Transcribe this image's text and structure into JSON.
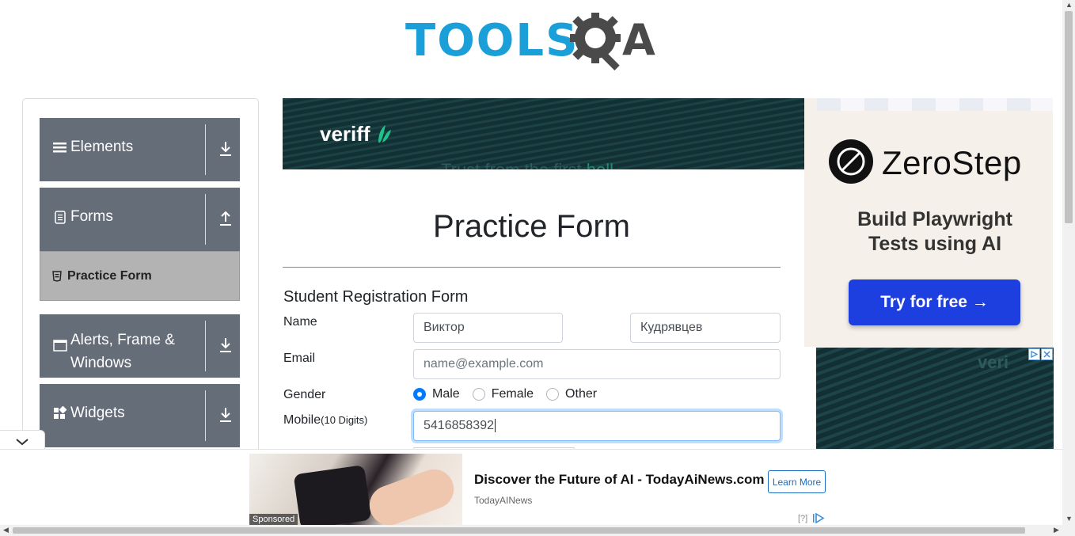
{
  "logo": {
    "text": "TOOLS",
    "suffix": "A",
    "colors": {
      "tools": "#1a9fd8",
      "qa": "#4a4a4a"
    }
  },
  "sidebar": {
    "groups": [
      {
        "label": "Elements",
        "icon": "hamburger-icon",
        "action_icon": "download-icon"
      },
      {
        "label": "Forms",
        "icon": "document-icon",
        "action_icon": "upload-icon",
        "items": [
          {
            "label": "Practice Form",
            "icon": "html5-icon",
            "active": true
          }
        ]
      },
      {
        "label": "Alerts, Frame & Windows",
        "icon": "window-icon",
        "action_icon": "download-icon"
      },
      {
        "label": "Widgets",
        "icon": "widgets-icon",
        "action_icon": "download-icon"
      }
    ],
    "collapse_icon": "chevron-down-icon"
  },
  "banner": {
    "brand": "veriff",
    "tagline_start": "Trust from the first ",
    "tagline_end": "hell"
  },
  "page": {
    "title": "Practice Form",
    "form_title": "Student Registration Form"
  },
  "form": {
    "name_label": "Name",
    "first_name": "Виктор",
    "last_name": "Кудрявцев",
    "email_label": "Email",
    "email_placeholder": "name@example.com",
    "gender_label": "Gender",
    "gender_options": [
      "Male",
      "Female",
      "Other"
    ],
    "gender_selected": "Male",
    "mobile_label": "Mobile",
    "mobile_hint": "(10 Digits)",
    "mobile_value": "5416858392"
  },
  "right_ad": {
    "brand": "ZeroStep",
    "subtitle": "Build Playwright Tests using AI",
    "cta": "Try for free →",
    "cta_color": "#1d3fe0",
    "ghost": "veri"
  },
  "bottom_ad": {
    "sponsored": "Sponsored",
    "headline": "Discover the Future of AI - TodayAiNews.com",
    "source": "TodayAINews",
    "cta": "Learn More",
    "info": "[?]"
  }
}
